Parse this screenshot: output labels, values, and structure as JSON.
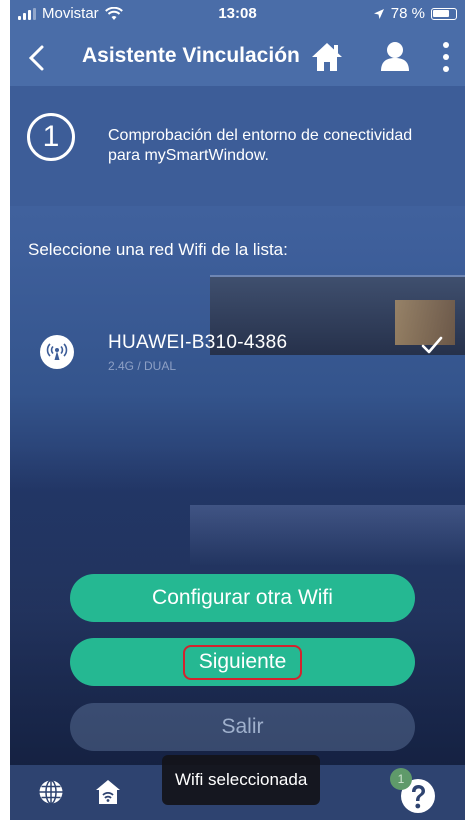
{
  "status_bar": {
    "carrier": "Movistar",
    "time": "13:08",
    "battery": "78 %",
    "battery_level": 0.78
  },
  "header": {
    "title": "Asistente Vinculación",
    "icons": [
      "chevron-left-icon",
      "home-icon",
      "user-icon",
      "more-vertical-icon"
    ]
  },
  "step": {
    "number": "1",
    "text": "Comprobación del entorno de conectividad para mySmartWindow."
  },
  "wifi_list": {
    "label": "Seleccione una red Wifi de la lista:",
    "networks": [
      {
        "name": "HUAWEI-B310-4386",
        "band": "2.4G / DUAL",
        "selected": true,
        "icon": "wifi-antenna-icon"
      }
    ]
  },
  "buttons": {
    "configure_other": "Configurar otra Wifi",
    "next": "Siguiente",
    "exit": "Salir"
  },
  "bottom_bar": {
    "toast": "Wifi seleccionada",
    "help_badge": "1",
    "icons": [
      "globe-icon",
      "house-wifi-icon",
      "help-icon"
    ]
  },
  "colors": {
    "header": "#4a6da8",
    "accent_green": "#25b892",
    "highlight_red": "#d3232e"
  }
}
